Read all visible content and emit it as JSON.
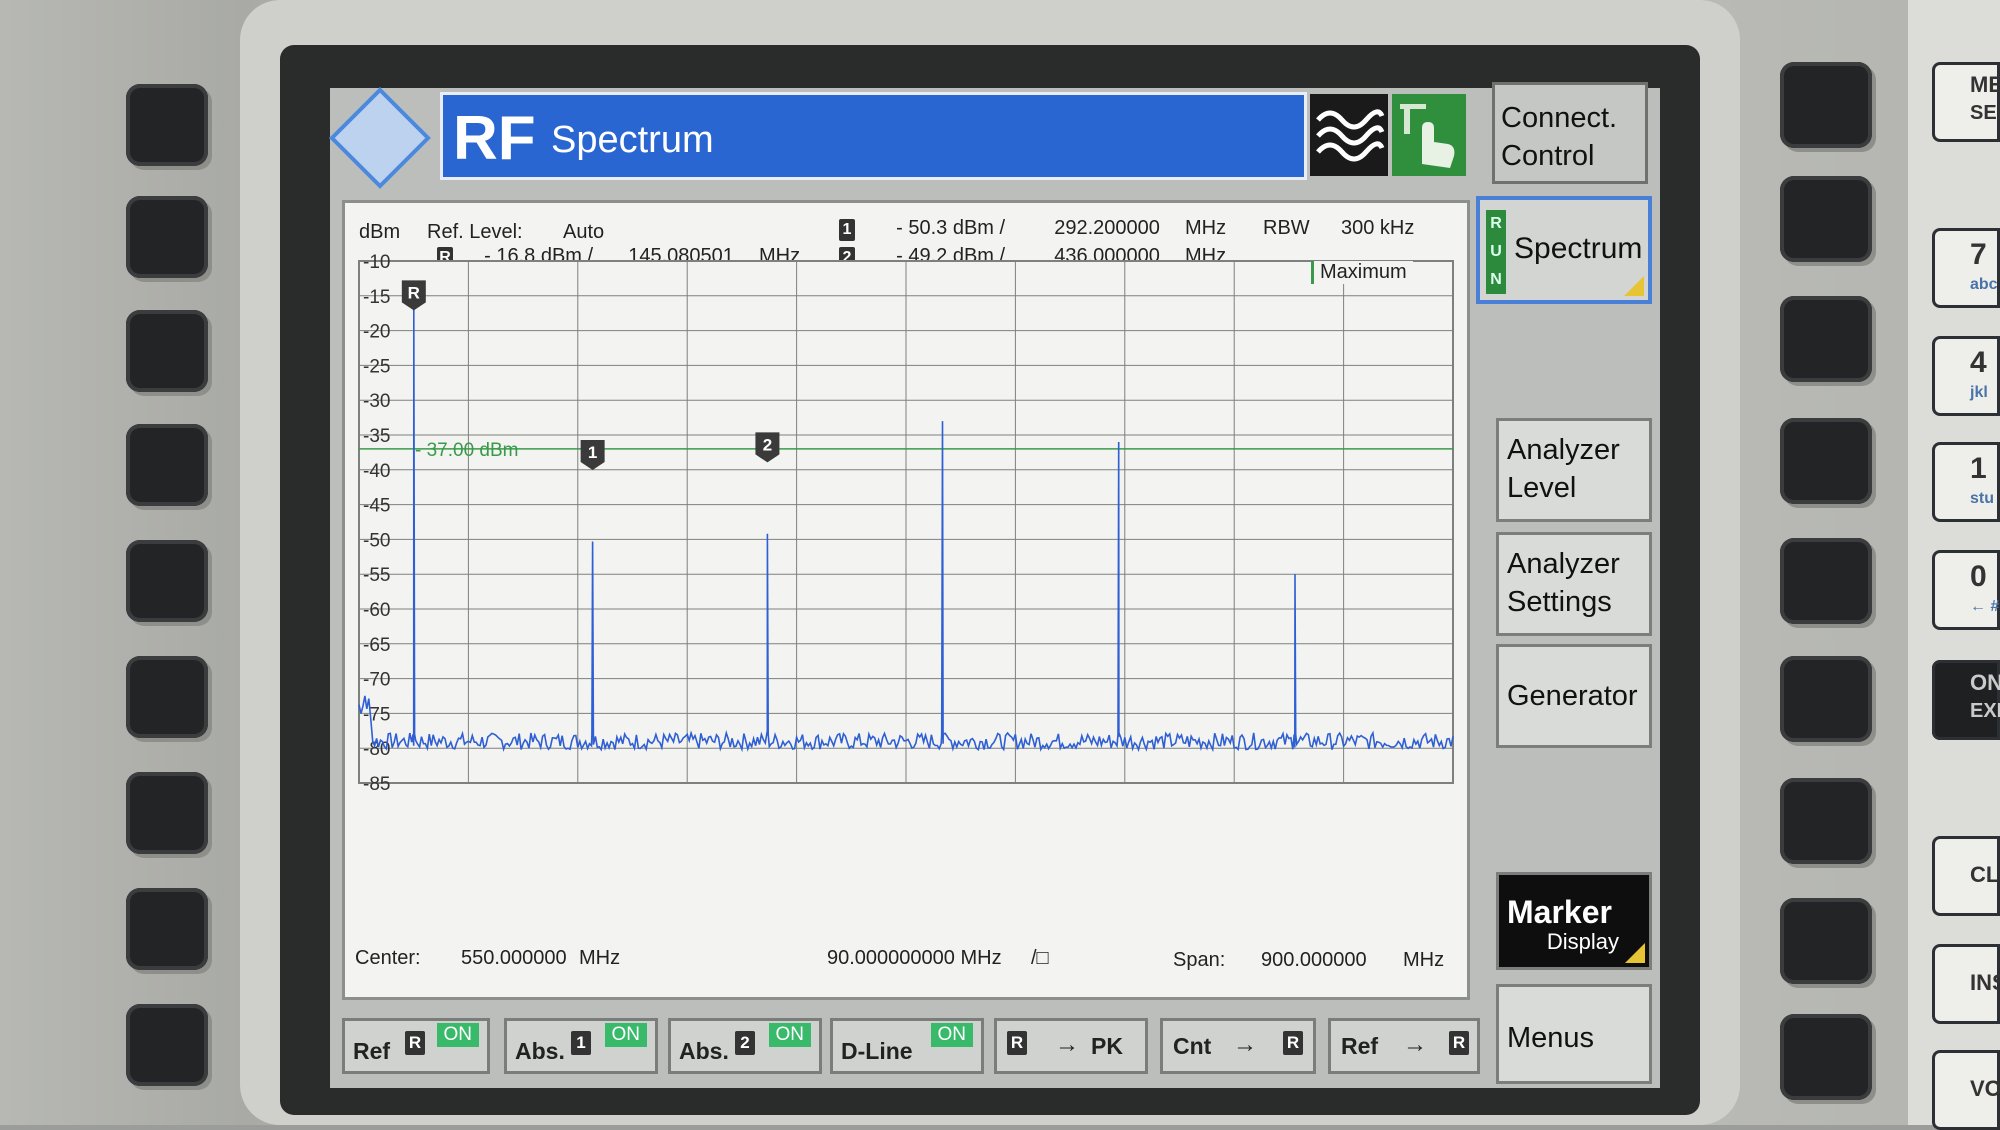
{
  "app": {
    "logo_text": "R&S",
    "mode": "RF",
    "title": "Spectrum",
    "connect_control": [
      "Connect.",
      "Control"
    ]
  },
  "header": {
    "unit": "dBm",
    "ref_level_label": "Ref. Level:",
    "ref_level_value": "Auto",
    "ref_marker": {
      "tag": "R",
      "level": "- 16.8",
      "level_unit": "dBm /",
      "freq": "145.080501",
      "freq_unit": "MHz"
    },
    "marker1": {
      "tag": "1",
      "level": "- 50.3",
      "level_unit": "dBm /",
      "freq": "292.200000",
      "freq_unit": "MHz"
    },
    "marker2": {
      "tag": "2",
      "level": "- 49.2",
      "level_unit": "dBm /",
      "freq": "436.000000",
      "freq_unit": "MHz"
    },
    "rbw_label": "RBW",
    "rbw_value": "300 kHz",
    "trace_mode": "Maximum"
  },
  "footer": {
    "center_label": "Center:",
    "center_value": "550.000000",
    "center_unit": "MHz",
    "div_value": "90.000000000 MHz",
    "div_unit": "/□",
    "span_label": "Span:",
    "span_value": "900.000000",
    "span_unit": "MHz"
  },
  "chart_data": {
    "type": "line",
    "x_unit": "MHz",
    "y_unit": "dBm",
    "xlim": [
      100,
      1000
    ],
    "ylim": [
      -85,
      -10
    ],
    "y_ticks": [
      "-10",
      "-15",
      "-20",
      "-25",
      "-30",
      "-35",
      "-40",
      "-45",
      "-50",
      "-55",
      "-60",
      "-65",
      "-70",
      "-75",
      "-80",
      "-85"
    ],
    "grid": true,
    "noise_floor": -79,
    "peaks": [
      {
        "x": 145.1,
        "y": -16.8
      },
      {
        "x": 292.2,
        "y": -50.3
      },
      {
        "x": 436.0,
        "y": -49.2
      },
      {
        "x": 580.0,
        "y": -33.0
      },
      {
        "x": 725.0,
        "y": -36.0
      },
      {
        "x": 870.0,
        "y": -55.0
      }
    ],
    "display_line": {
      "y": -37.0,
      "label": "- 37.00 dBm"
    },
    "markers": [
      {
        "tag": "R",
        "x": 145.1,
        "y": -16.8
      },
      {
        "tag": "1",
        "x": 292.2,
        "y": -50.3
      },
      {
        "tag": "2",
        "x": 436.0,
        "y": -49.2
      }
    ]
  },
  "softkeys": {
    "run": [
      "R",
      "U",
      "N"
    ],
    "spectrum": "Spectrum",
    "analyzer_level": [
      "Analyzer",
      "Level"
    ],
    "analyzer_settings": [
      "Analyzer",
      "Settings"
    ],
    "generator": "Generator",
    "marker": "Marker",
    "marker_sub": "Display",
    "menus": "Menus"
  },
  "bottom_keys": {
    "ref": {
      "label": "Ref",
      "tag": "R",
      "state": "ON"
    },
    "abs1": {
      "label": "Abs.",
      "tag": "1",
      "state": "ON"
    },
    "abs2": {
      "label": "Abs.",
      "tag": "2",
      "state": "ON"
    },
    "dline": {
      "label": "D-Line",
      "state": "ON"
    },
    "r_to_pk": {
      "tag": "R",
      "arrow": "→",
      "label": "PK"
    },
    "cnt_to_r": {
      "label": "Cnt",
      "arrow": "→",
      "tag": "R"
    },
    "ref_to_r": {
      "label": "Ref",
      "arrow": "→",
      "tag": "R"
    }
  },
  "keypad": [
    {
      "main": "ME",
      "sub": "SEL"
    },
    {
      "main": "7",
      "sub": "abc"
    },
    {
      "main": "4",
      "sub": "jkl"
    },
    {
      "main": "1",
      "sub": "stu"
    },
    {
      "main": "0",
      "sub": "← #"
    },
    {
      "main": "ON",
      "sub": "EXP"
    },
    {
      "main": "CL",
      "sub": ""
    },
    {
      "main": "INS",
      "sub": ""
    },
    {
      "main": "VO",
      "sub": ""
    }
  ],
  "colors": {
    "title_blue": "#2a66d2",
    "trace": "#2f5fd4",
    "display_line": "#3a9a4a",
    "grid": "#7d807c",
    "on_green": "#39b96a",
    "run_green": "#2c8a3c",
    "corner_yellow": "#e7c436"
  }
}
